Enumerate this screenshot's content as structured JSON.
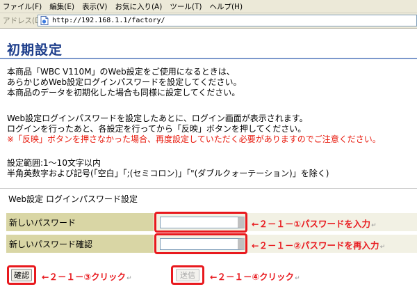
{
  "menu": [
    "ファイル(F)",
    "編集(E)",
    "表示(V)",
    "お気に入り(A)",
    "ツール(T)",
    "ヘルプ(H)"
  ],
  "address_bar": {
    "label": "アドレス(D)",
    "url": "http://192.168.1.1/factory/"
  },
  "page": {
    "title": "初期設定",
    "intro": [
      "本商品「WBC V110M」のWeb設定をご使用になるときは、",
      "あらかじめWeb設定ログインパスワードを設定してください。",
      "本商品のデータを初期化した場合も同様に設定してください。"
    ],
    "info": [
      "Web設定ログインパスワードを設定したあとに、ログイン画面が表示されます。",
      "ログインを行ったあと、各設定を行ってから「反映」ボタンを押してください。"
    ],
    "warning": "※「反映」ボタンを押さなかった場合、再度設定していただく必要がありますのでご注意ください。",
    "range": [
      "設定範囲:1～10文字以内",
      "半角英数字および記号(「空白」「;(セミコロン)」「\"(ダブルクォーテーション)」を除く)"
    ],
    "section_title": "Web設定 ログインパスワード設定",
    "fields": [
      {
        "label": "新しいパスワード",
        "value": ""
      },
      {
        "label": "新しいパスワード確認",
        "value": ""
      }
    ],
    "confirm_button": "確認",
    "send_button": "送信"
  },
  "annotations": {
    "a1": "←２－１－①パスワードを入力",
    "a2": "←２－１－②パスワードを再入力",
    "a3": "←２－１－③クリック",
    "a4": "←２－１－④クリック",
    "return_mark": "↵"
  },
  "colors": {
    "title": "#1b3c8a",
    "warning": "#e8190c",
    "annotation": "#e8191e",
    "label_bg": "#d9d6a5"
  }
}
